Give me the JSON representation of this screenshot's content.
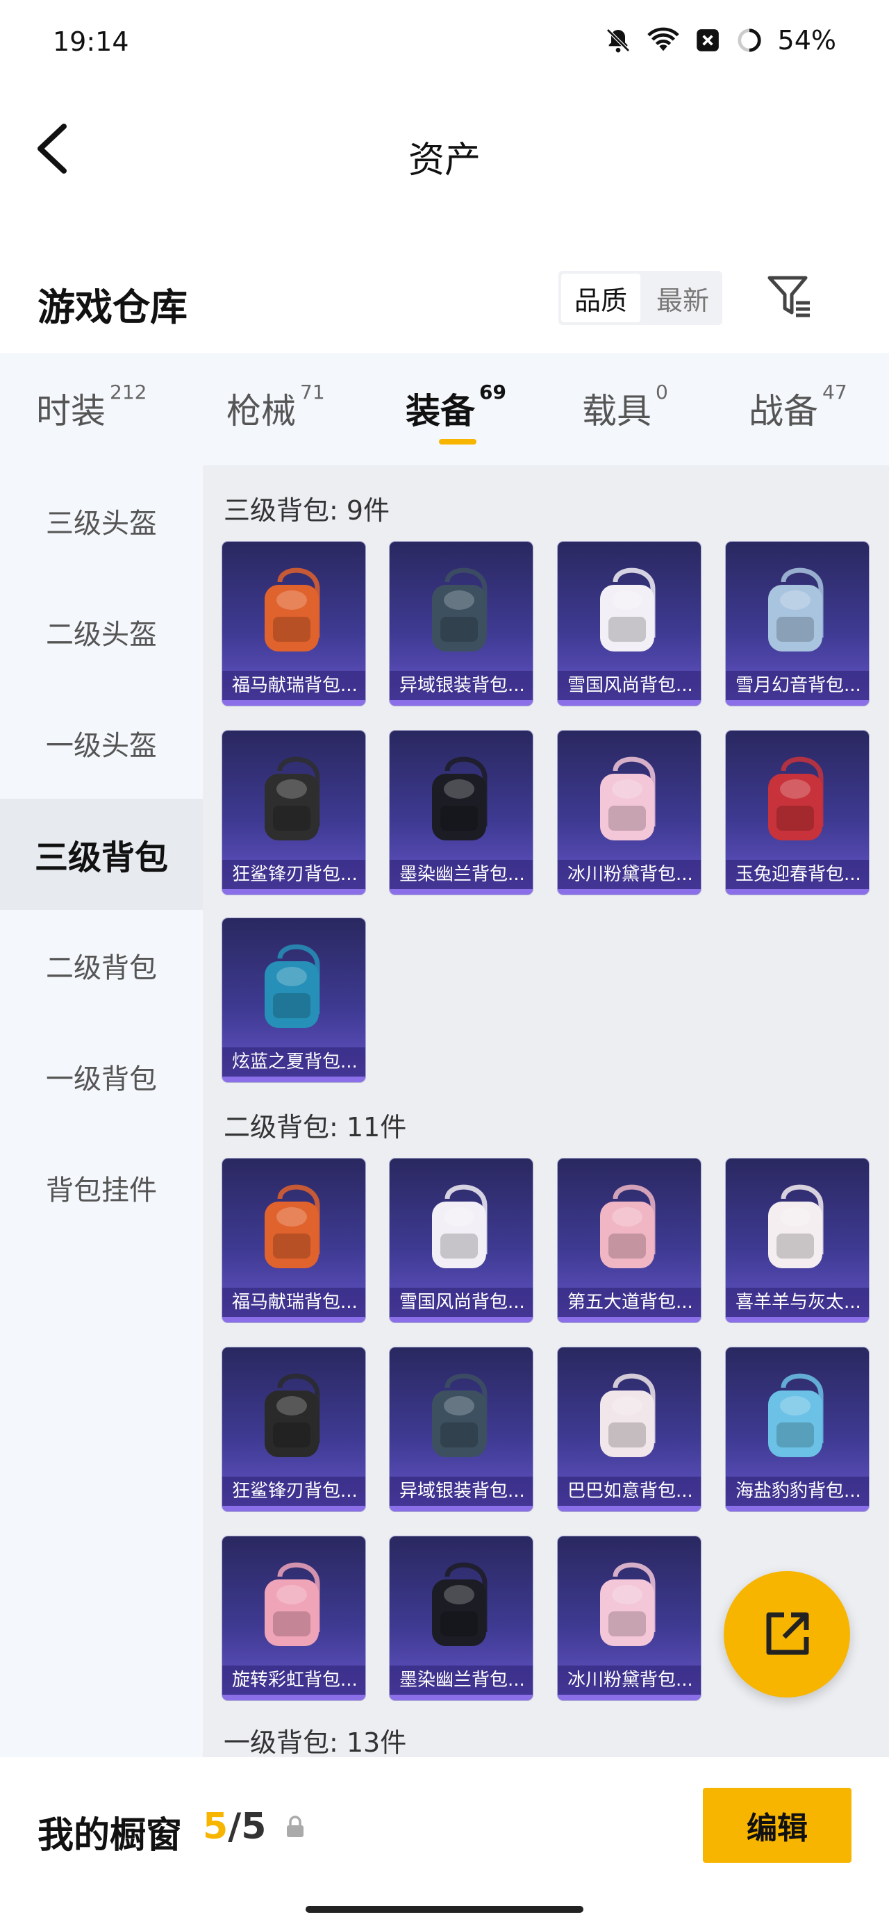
{
  "status": {
    "time": "19:14",
    "battery": "54%"
  },
  "nav": {
    "title": "资产"
  },
  "warehouse": {
    "title": "游戏仓库",
    "sort_quality": "品质",
    "sort_newest": "最新"
  },
  "tabs": [
    {
      "label": "时装",
      "count": "212"
    },
    {
      "label": "枪械",
      "count": "71"
    },
    {
      "label": "装备",
      "count": "69"
    },
    {
      "label": "载具",
      "count": "0"
    },
    {
      "label": "战备",
      "count": "47"
    }
  ],
  "sidebar": [
    {
      "label": "三级头盔"
    },
    {
      "label": "二级头盔"
    },
    {
      "label": "一级头盔"
    },
    {
      "label": "三级背包"
    },
    {
      "label": "二级背包"
    },
    {
      "label": "一级背包"
    },
    {
      "label": "背包挂件"
    }
  ],
  "sections": [
    {
      "title": "三级背包: 9件",
      "items": [
        {
          "name": "福马献瑞背包...",
          "color": "#e0622c"
        },
        {
          "name": "异域银装背包...",
          "color": "#3d5060"
        },
        {
          "name": "雪国风尚背包...",
          "color": "#f2f0f6"
        },
        {
          "name": "雪月幻音背包...",
          "color": "#a9c4df"
        },
        {
          "name": "狂鲨锋刃背包...",
          "color": "#2e2e2e"
        },
        {
          "name": "墨染幽兰背包...",
          "color": "#1c1c24"
        },
        {
          "name": "冰川粉黛背包...",
          "color": "#f3c6d8"
        },
        {
          "name": "玉兔迎春背包...",
          "color": "#c8323a"
        },
        {
          "name": "炫蓝之夏背包...",
          "color": "#2790b8"
        }
      ]
    },
    {
      "title": "二级背包: 11件",
      "items": [
        {
          "name": "福马献瑞背包...",
          "color": "#e0622c"
        },
        {
          "name": "雪国风尚背包...",
          "color": "#f2f0f6"
        },
        {
          "name": "第五大道背包...",
          "color": "#f0b6c4"
        },
        {
          "name": "喜羊羊与灰太...",
          "color": "#f4eef0"
        },
        {
          "name": "狂鲨锋刃背包...",
          "color": "#2a2a2a"
        },
        {
          "name": "异域银装背包...",
          "color": "#3d5060"
        },
        {
          "name": "巴巴如意背包...",
          "color": "#f1e6ea"
        },
        {
          "name": "海盐豹豹背包...",
          "color": "#6cc2e6"
        },
        {
          "name": "旋转彩虹背包...",
          "color": "#f0a4b8"
        },
        {
          "name": "墨染幽兰背包...",
          "color": "#1c1c24"
        },
        {
          "name": "冰川粉黛背包...",
          "color": "#f3c6d8"
        }
      ]
    },
    {
      "title": "一级背包: 13件",
      "items": []
    }
  ],
  "bottom": {
    "title": "我的橱窗",
    "count_current": "5",
    "count_sep": "/",
    "count_total": "5",
    "edit_label": "编辑"
  },
  "colors": {
    "accent": "#f7b500",
    "card_bg": "#3e3a92"
  },
  "icons": {
    "back": "chevron-left-icon",
    "filter": "filter-icon",
    "share": "share-out-icon",
    "lock": "lock-icon",
    "bell_off": "bell-off-icon",
    "wifi": "wifi-icon",
    "battery": "battery-icon"
  }
}
